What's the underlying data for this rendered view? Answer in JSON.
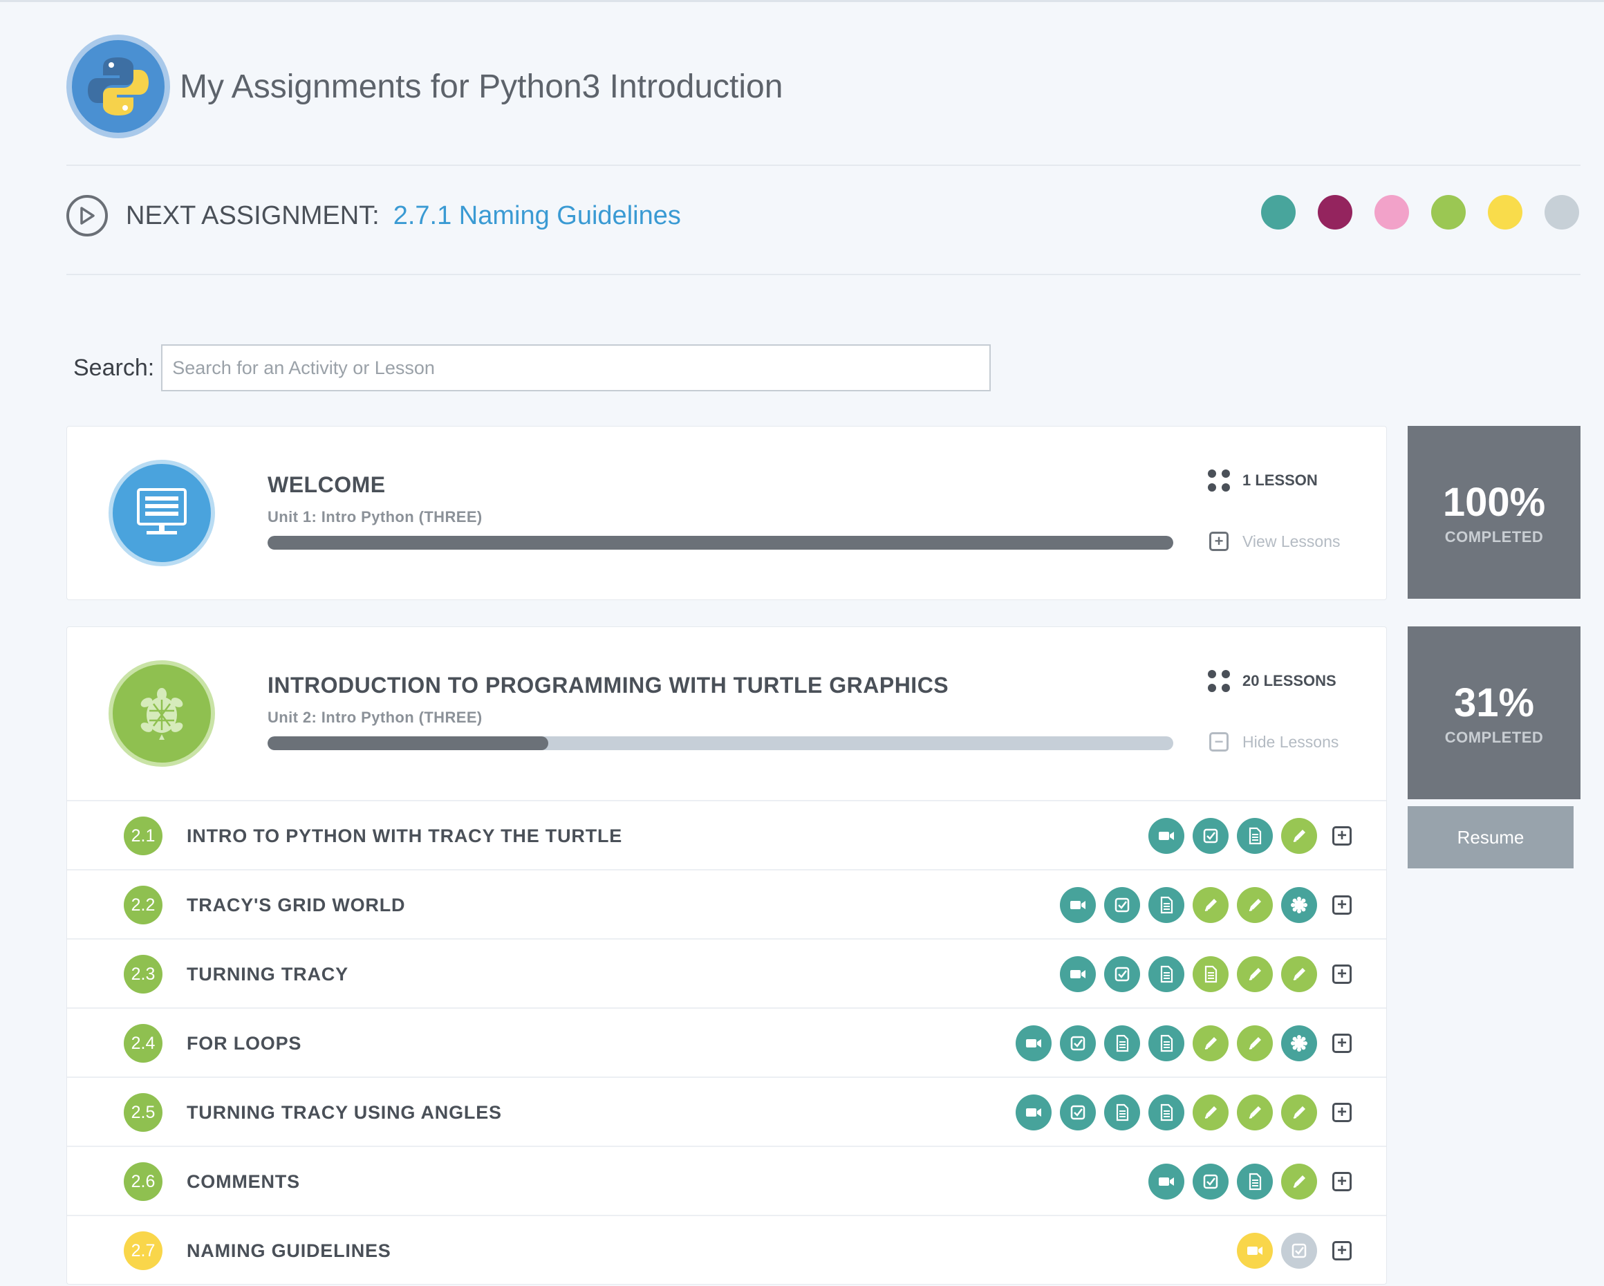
{
  "header": {
    "title": "My Assignments for Python3 Introduction",
    "logo_icon": "python-logo-icon"
  },
  "next_assignment": {
    "label": "NEXT ASSIGNMENT:",
    "link": "2.7.1 Naming Guidelines"
  },
  "color_dots": [
    "#48a59c",
    "#94245e",
    "#f2a2c9",
    "#9bc753",
    "#f9dc4b",
    "#c7d0d7"
  ],
  "search": {
    "label": "Search:",
    "placeholder": "Search for an Activity or Lesson",
    "value": ""
  },
  "units": [
    {
      "title": "WELCOME",
      "subtitle": "Unit 1: Intro Python (THREE)",
      "lessons_count": "1 LESSON",
      "toggle_label": "View Lessons",
      "progress": 1.0,
      "completed_pct": "100%",
      "completed_label": "COMPLETED",
      "icon": "monitor-icon",
      "icon_color": "#4aa3dd"
    },
    {
      "title": "INTRODUCTION TO PROGRAMMING WITH TURTLE GRAPHICS",
      "subtitle": "Unit 2: Intro Python (THREE)",
      "lessons_count": "20 LESSONS",
      "toggle_label": "Hide Lessons",
      "progress": 0.31,
      "completed_pct": "31%",
      "completed_label": "COMPLETED",
      "icon": "turtle-icon",
      "icon_color": "#8fc050",
      "resume_label": "Resume"
    }
  ],
  "lessons": [
    {
      "num": "2.1",
      "title": "INTRO TO PYTHON WITH TRACY THE TURTLE",
      "num_color": "#8fc050",
      "activities": [
        [
          "video",
          "teal"
        ],
        [
          "check",
          "teal"
        ],
        [
          "doc",
          "teal"
        ],
        [
          "pencil",
          "green"
        ]
      ]
    },
    {
      "num": "2.2",
      "title": "TRACY'S GRID WORLD",
      "num_color": "#8fc050",
      "activities": [
        [
          "video",
          "teal"
        ],
        [
          "check",
          "teal"
        ],
        [
          "doc",
          "teal"
        ],
        [
          "pencil",
          "green"
        ],
        [
          "pencil",
          "green"
        ],
        [
          "badge",
          "teal"
        ]
      ]
    },
    {
      "num": "2.3",
      "title": "TURNING TRACY",
      "num_color": "#8fc050",
      "activities": [
        [
          "video",
          "teal"
        ],
        [
          "check",
          "teal"
        ],
        [
          "doc",
          "teal"
        ],
        [
          "doc",
          "green"
        ],
        [
          "pencil",
          "green"
        ],
        [
          "pencil",
          "green"
        ]
      ]
    },
    {
      "num": "2.4",
      "title": "FOR LOOPS",
      "num_color": "#8fc050",
      "activities": [
        [
          "video",
          "teal"
        ],
        [
          "check",
          "teal"
        ],
        [
          "doc",
          "teal"
        ],
        [
          "doc",
          "teal"
        ],
        [
          "pencil",
          "green"
        ],
        [
          "pencil",
          "green"
        ],
        [
          "badge",
          "teal"
        ]
      ]
    },
    {
      "num": "2.5",
      "title": "TURNING TRACY USING ANGLES",
      "num_color": "#8fc050",
      "activities": [
        [
          "video",
          "teal"
        ],
        [
          "check",
          "teal"
        ],
        [
          "doc",
          "teal"
        ],
        [
          "doc",
          "teal"
        ],
        [
          "pencil",
          "green"
        ],
        [
          "pencil",
          "green"
        ],
        [
          "pencil",
          "green"
        ]
      ]
    },
    {
      "num": "2.6",
      "title": "COMMENTS",
      "num_color": "#8fc050",
      "activities": [
        [
          "video",
          "teal"
        ],
        [
          "check",
          "teal"
        ],
        [
          "doc",
          "teal"
        ],
        [
          "pencil",
          "green"
        ]
      ]
    },
    {
      "num": "2.7",
      "title": "NAMING GUIDELINES",
      "num_color": "#f9d64a",
      "activities": [
        [
          "video",
          "yellow"
        ],
        [
          "check",
          "gray"
        ]
      ]
    }
  ]
}
